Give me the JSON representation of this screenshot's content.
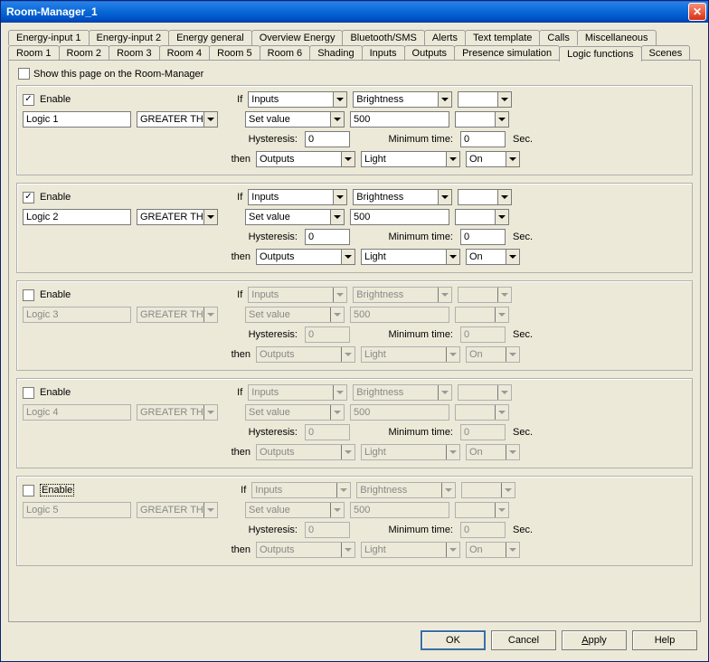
{
  "window": {
    "title": "Room-Manager_1"
  },
  "tabs_row1": [
    "Energy-input 1",
    "Energy-input 2",
    "Energy general",
    "Overview Energy",
    "Bluetooth/SMS",
    "Alerts",
    "Text template",
    "Calls",
    "Miscellaneous"
  ],
  "tabs_row2": [
    "Room 1",
    "Room 2",
    "Room 3",
    "Room 4",
    "Room 5",
    "Room 6",
    "Shading",
    "Inputs",
    "Outputs",
    "Presence simulation",
    "Logic functions",
    "Scenes"
  ],
  "active_tab": "Logic functions",
  "showpage_label": "Show this page on the Room-Manager",
  "labels": {
    "enable": "Enable",
    "if": "If",
    "then": "then",
    "hysteresis": "Hysteresis:",
    "mintime": "Minimum time:",
    "sec": "Sec."
  },
  "buttons": {
    "ok": "OK",
    "cancel": "Cancel",
    "apply": "Apply",
    "help": "Help"
  },
  "logics": [
    {
      "enabled": true,
      "name": "Logic 1",
      "op": "GREATER THAN",
      "if_a": "Inputs",
      "if_b": "Brightness",
      "if_c": "",
      "set_a": "Set value",
      "set_b": "500",
      "set_c": "",
      "hyst": "0",
      "mintime": "0",
      "then_a": "Outputs",
      "then_b": "Light",
      "then_c": "On"
    },
    {
      "enabled": true,
      "name": "Logic 2",
      "op": "GREATER THAN",
      "if_a": "Inputs",
      "if_b": "Brightness",
      "if_c": "",
      "set_a": "Set value",
      "set_b": "500",
      "set_c": "",
      "hyst": "0",
      "mintime": "0",
      "then_a": "Outputs",
      "then_b": "Light",
      "then_c": "On"
    },
    {
      "enabled": false,
      "name": "Logic 3",
      "op": "GREATER THAN",
      "if_a": "Inputs",
      "if_b": "Brightness",
      "if_c": "",
      "set_a": "Set value",
      "set_b": "500",
      "set_c": "",
      "hyst": "0",
      "mintime": "0",
      "then_a": "Outputs",
      "then_b": "Light",
      "then_c": "On"
    },
    {
      "enabled": false,
      "name": "Logic 4",
      "op": "GREATER THAN",
      "if_a": "Inputs",
      "if_b": "Brightness",
      "if_c": "",
      "set_a": "Set value",
      "set_b": "500",
      "set_c": "",
      "hyst": "0",
      "mintime": "0",
      "then_a": "Outputs",
      "then_b": "Light",
      "then_c": "On"
    },
    {
      "enabled": false,
      "focused_enable": true,
      "name": "Logic 5",
      "op": "GREATER THAN",
      "if_a": "Inputs",
      "if_b": "Brightness",
      "if_c": "",
      "set_a": "Set value",
      "set_b": "500",
      "set_c": "",
      "hyst": "0",
      "mintime": "0",
      "then_a": "Outputs",
      "then_b": "Light",
      "then_c": "On"
    }
  ]
}
